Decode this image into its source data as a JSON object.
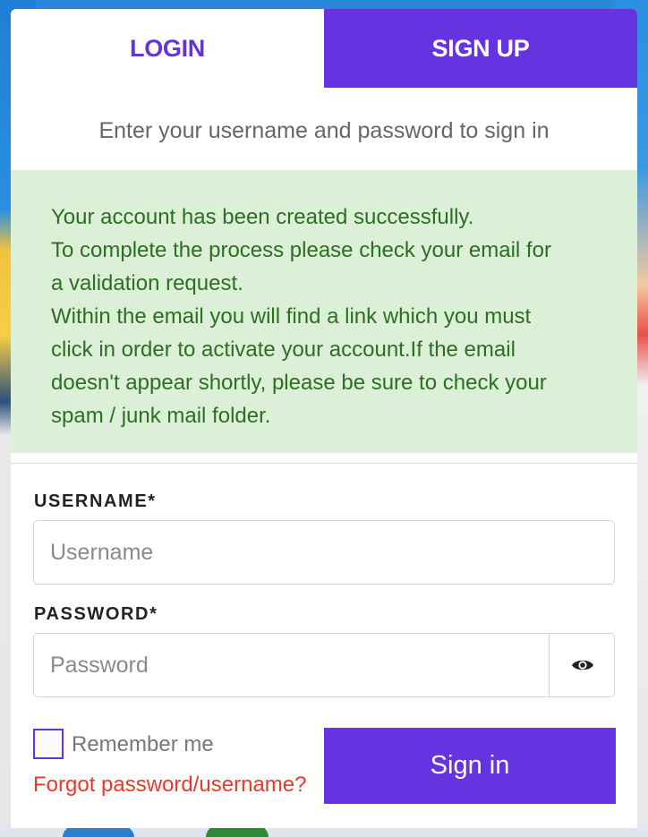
{
  "tabs": {
    "login_label": "LOGIN",
    "signup_label": "SIGN UP"
  },
  "subtitle": "Enter your username and password to sign in",
  "alert": {
    "lines": [
      "Your account has been created successfully.",
      "To complete the process please check your email for",
      "a validation request.",
      "Within the email you will find a link which you must",
      "click in order to activate your account.If the email",
      "doesn't appear shortly, please be sure to check your",
      "spam / junk mail folder."
    ]
  },
  "form": {
    "username_label": "USERNAME*",
    "username_placeholder": "Username",
    "username_value": "",
    "password_label": "PASSWORD*",
    "password_placeholder": "Password",
    "password_value": "",
    "show_password_icon": "eye-icon",
    "remember_label": "Remember me",
    "remember_checked": false,
    "forgot_label": "Forgot password/username?",
    "signin_label": "Sign in"
  },
  "colors": {
    "accent": "#6633e0",
    "success_bg": "#dcf0d8",
    "success_text": "#2c6e22",
    "link_error": "#e83a2a"
  }
}
